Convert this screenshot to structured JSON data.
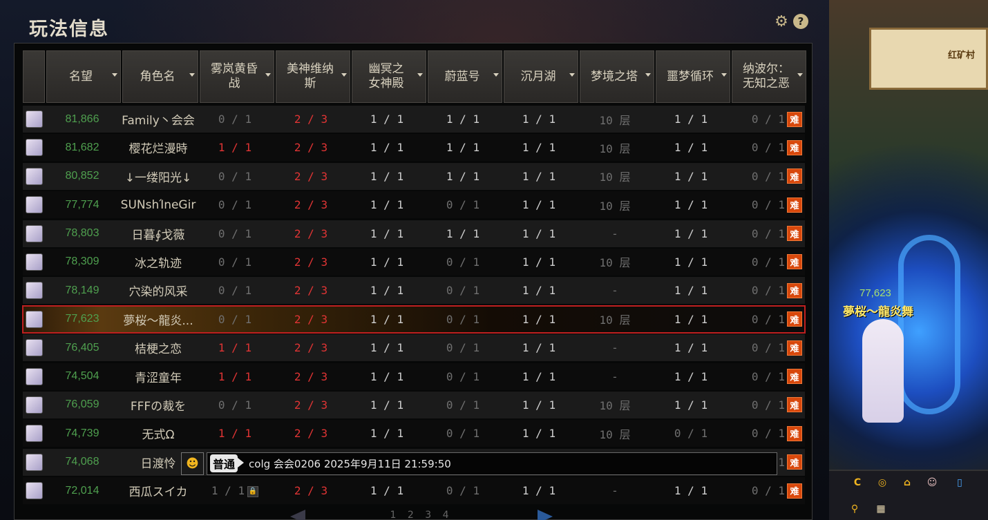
{
  "panel": {
    "title": "玩法信息",
    "help_label": "?"
  },
  "columns": [
    {
      "label": "名望"
    },
    {
      "label": "角色名"
    },
    {
      "label": "雾岚黄昏\n战"
    },
    {
      "label": "美神维纳\n斯"
    },
    {
      "label": "幽冥之\n女神殿"
    },
    {
      "label": "蔚蓝号"
    },
    {
      "label": "沉月湖"
    },
    {
      "label": "梦境之塔"
    },
    {
      "label": "噩梦循环"
    },
    {
      "label": "纳波尔：\n无知之恶"
    }
  ],
  "difficulty_badge": "难",
  "rows": [
    {
      "fame": "81,866",
      "name": "Family丶会会",
      "v": [
        "0 / 1",
        "2 / 3",
        "1 / 1",
        "1 / 1",
        "1 / 1",
        "10 层",
        "1 / 1",
        "0 / 1"
      ],
      "cls": [
        "gray",
        "red",
        "wht",
        "wht",
        "wht",
        "gray",
        "wht",
        "gray"
      ]
    },
    {
      "fame": "81,682",
      "name": "樱花烂漫時",
      "v": [
        "1 / 1",
        "2 / 3",
        "1 / 1",
        "1 / 1",
        "1 / 1",
        "10 层",
        "1 / 1",
        "0 / 1"
      ],
      "cls": [
        "red",
        "red",
        "wht",
        "wht",
        "wht",
        "gray",
        "wht",
        "gray"
      ]
    },
    {
      "fame": "80,852",
      "name": "↓一缕阳光↓",
      "v": [
        "0 / 1",
        "2 / 3",
        "1 / 1",
        "1 / 1",
        "1 / 1",
        "10 层",
        "1 / 1",
        "0 / 1"
      ],
      "cls": [
        "gray",
        "red",
        "wht",
        "wht",
        "wht",
        "gray",
        "wht",
        "gray"
      ]
    },
    {
      "fame": "77,774",
      "name": "SUNshΊneGir",
      "v": [
        "0 / 1",
        "2 / 3",
        "1 / 1",
        "0 / 1",
        "1 / 1",
        "10 层",
        "1 / 1",
        "0 / 1"
      ],
      "cls": [
        "gray",
        "red",
        "wht",
        "gray",
        "wht",
        "gray",
        "wht",
        "gray"
      ]
    },
    {
      "fame": "78,803",
      "name": "日暮∮戈薇",
      "v": [
        "0 / 1",
        "2 / 3",
        "1 / 1",
        "1 / 1",
        "1 / 1",
        "-",
        "1 / 1",
        "0 / 1"
      ],
      "cls": [
        "gray",
        "red",
        "wht",
        "wht",
        "wht",
        "gray",
        "wht",
        "gray"
      ]
    },
    {
      "fame": "78,309",
      "name": "冰之轨迹",
      "v": [
        "0 / 1",
        "2 / 3",
        "1 / 1",
        "0 / 1",
        "1 / 1",
        "10 层",
        "1 / 1",
        "0 / 1"
      ],
      "cls": [
        "gray",
        "red",
        "wht",
        "gray",
        "wht",
        "gray",
        "wht",
        "gray"
      ]
    },
    {
      "fame": "78,149",
      "name": "穴染的风采",
      "v": [
        "0 / 1",
        "2 / 3",
        "1 / 1",
        "0 / 1",
        "1 / 1",
        "-",
        "1 / 1",
        "0 / 1"
      ],
      "cls": [
        "gray",
        "red",
        "wht",
        "gray",
        "wht",
        "gray",
        "wht",
        "gray"
      ]
    },
    {
      "fame": "77,623",
      "name": "夢桜～龍炎...",
      "v": [
        "0 / 1",
        "2 / 3",
        "1 / 1",
        "0 / 1",
        "1 / 1",
        "10 层",
        "1 / 1",
        "0 / 1"
      ],
      "cls": [
        "gray",
        "red",
        "wht",
        "gray",
        "wht",
        "gray",
        "wht",
        "gray"
      ],
      "selected": true
    },
    {
      "fame": "76,405",
      "name": "桔梗之恋",
      "v": [
        "1 / 1",
        "2 / 3",
        "1 / 1",
        "0 / 1",
        "1 / 1",
        "-",
        "1 / 1",
        "0 / 1"
      ],
      "cls": [
        "red",
        "red",
        "wht",
        "gray",
        "wht",
        "gray",
        "wht",
        "gray"
      ]
    },
    {
      "fame": "74,504",
      "name": "青涩童年",
      "v": [
        "1 / 1",
        "2 / 3",
        "1 / 1",
        "0 / 1",
        "1 / 1",
        "-",
        "1 / 1",
        "0 / 1"
      ],
      "cls": [
        "red",
        "red",
        "wht",
        "gray",
        "wht",
        "gray",
        "wht",
        "gray"
      ]
    },
    {
      "fame": "76,059",
      "name": "FFFの裁を",
      "v": [
        "0 / 1",
        "2 / 3",
        "1 / 1",
        "0 / 1",
        "1 / 1",
        "10 层",
        "1 / 1",
        "0 / 1"
      ],
      "cls": [
        "gray",
        "red",
        "wht",
        "gray",
        "wht",
        "gray",
        "wht",
        "gray"
      ]
    },
    {
      "fame": "74,739",
      "name": "无式Ω",
      "v": [
        "1 / 1",
        "2 / 3",
        "1 / 1",
        "0 / 1",
        "1 / 1",
        "10 层",
        "0 / 1",
        "0 / 1"
      ],
      "cls": [
        "red",
        "red",
        "wht",
        "gray",
        "wht",
        "gray",
        "gray",
        "gray"
      ]
    },
    {
      "fame": "74,068",
      "name": "日渡怜",
      "v": [
        "",
        "",
        "",
        "",
        "",
        "",
        "",
        "1"
      ],
      "cls": [
        "gray",
        "gray",
        "gray",
        "gray",
        "gray",
        "gray",
        "gray",
        "gray"
      ]
    },
    {
      "fame": "72,014",
      "name": "西瓜スイカ",
      "v": [
        "1 / 1",
        "2 / 3",
        "1 / 1",
        "0 / 1",
        "1 / 1",
        "-",
        "1 / 1",
        "0 / 1"
      ],
      "cls": [
        "gray",
        "red",
        "wht",
        "gray",
        "wht",
        "gray",
        "wht",
        "gray"
      ],
      "lock": true
    }
  ],
  "chat": {
    "channel": "普通",
    "message": "colg 会会0206  2025年9月11日 21:59:50"
  },
  "pager": {
    "dots": "1 2 3 4"
  },
  "scene": {
    "location_sign": "红矿村",
    "player_fame": "77,623",
    "player_name": "夢桜～龍炎舞"
  }
}
